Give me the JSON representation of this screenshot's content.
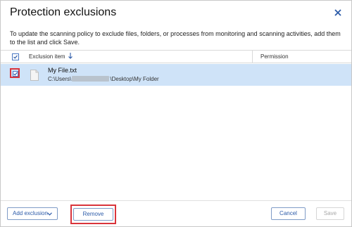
{
  "dialog": {
    "title": "Protection exclusions",
    "description": "To update the scanning policy to exclude files, folders, or processes from monitoring and scanning activities, add them to the list and click Save."
  },
  "table": {
    "columns": {
      "name": "Exclusion item",
      "permission": "Permission"
    },
    "rows": [
      {
        "name": "My File.txt",
        "path_prefix": "C:\\Users\\",
        "path_suffix": "\\Desktop\\My Folder",
        "checked": true
      }
    ]
  },
  "footer": {
    "add_label": "Add exclusion",
    "remove_label": "Remove",
    "cancel_label": "Cancel",
    "save_label": "Save"
  },
  "colors": {
    "accent": "#2b5aa8",
    "selected_row": "#cfe3f8",
    "highlight": "#d9343b"
  },
  "icons": {
    "close": "close-icon",
    "sort": "arrow-down-icon",
    "file": "file-icon",
    "dropdown": "chevron-down-icon"
  }
}
